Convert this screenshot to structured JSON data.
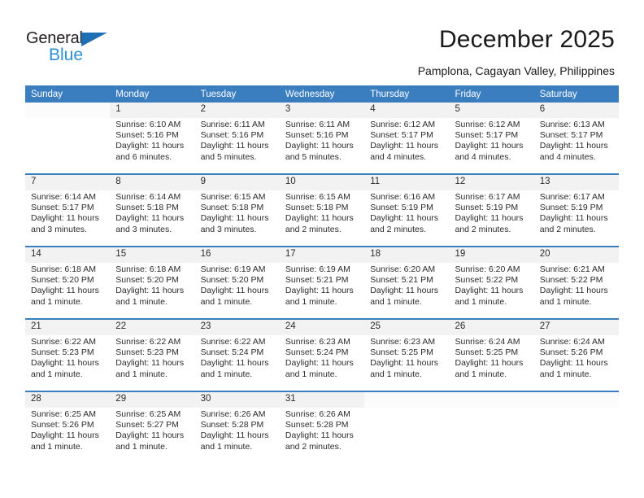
{
  "brand": {
    "name_top": "General",
    "name_bottom": "Blue",
    "accent_color": "#2b8fd6",
    "triangle_color": "#1f6fb5"
  },
  "header": {
    "title": "December 2025",
    "subtitle": "Pamplona, Cagayan Valley, Philippines"
  },
  "calendar": {
    "header_bg": "#3b7ebf",
    "daynum_bg": "#f2f2f2",
    "weekday_names": [
      "Sunday",
      "Monday",
      "Tuesday",
      "Wednesday",
      "Thursday",
      "Friday",
      "Saturday"
    ],
    "weeks": [
      [
        {
          "day": "",
          "sunrise": "",
          "sunset": "",
          "daylight": ""
        },
        {
          "day": "1",
          "sunrise": "Sunrise: 6:10 AM",
          "sunset": "Sunset: 5:16 PM",
          "daylight": "Daylight: 11 hours and 6 minutes."
        },
        {
          "day": "2",
          "sunrise": "Sunrise: 6:11 AM",
          "sunset": "Sunset: 5:16 PM",
          "daylight": "Daylight: 11 hours and 5 minutes."
        },
        {
          "day": "3",
          "sunrise": "Sunrise: 6:11 AM",
          "sunset": "Sunset: 5:16 PM",
          "daylight": "Daylight: 11 hours and 5 minutes."
        },
        {
          "day": "4",
          "sunrise": "Sunrise: 6:12 AM",
          "sunset": "Sunset: 5:17 PM",
          "daylight": "Daylight: 11 hours and 4 minutes."
        },
        {
          "day": "5",
          "sunrise": "Sunrise: 6:12 AM",
          "sunset": "Sunset: 5:17 PM",
          "daylight": "Daylight: 11 hours and 4 minutes."
        },
        {
          "day": "6",
          "sunrise": "Sunrise: 6:13 AM",
          "sunset": "Sunset: 5:17 PM",
          "daylight": "Daylight: 11 hours and 4 minutes."
        }
      ],
      [
        {
          "day": "7",
          "sunrise": "Sunrise: 6:14 AM",
          "sunset": "Sunset: 5:17 PM",
          "daylight": "Daylight: 11 hours and 3 minutes."
        },
        {
          "day": "8",
          "sunrise": "Sunrise: 6:14 AM",
          "sunset": "Sunset: 5:18 PM",
          "daylight": "Daylight: 11 hours and 3 minutes."
        },
        {
          "day": "9",
          "sunrise": "Sunrise: 6:15 AM",
          "sunset": "Sunset: 5:18 PM",
          "daylight": "Daylight: 11 hours and 3 minutes."
        },
        {
          "day": "10",
          "sunrise": "Sunrise: 6:15 AM",
          "sunset": "Sunset: 5:18 PM",
          "daylight": "Daylight: 11 hours and 2 minutes."
        },
        {
          "day": "11",
          "sunrise": "Sunrise: 6:16 AM",
          "sunset": "Sunset: 5:19 PM",
          "daylight": "Daylight: 11 hours and 2 minutes."
        },
        {
          "day": "12",
          "sunrise": "Sunrise: 6:17 AM",
          "sunset": "Sunset: 5:19 PM",
          "daylight": "Daylight: 11 hours and 2 minutes."
        },
        {
          "day": "13",
          "sunrise": "Sunrise: 6:17 AM",
          "sunset": "Sunset: 5:19 PM",
          "daylight": "Daylight: 11 hours and 2 minutes."
        }
      ],
      [
        {
          "day": "14",
          "sunrise": "Sunrise: 6:18 AM",
          "sunset": "Sunset: 5:20 PM",
          "daylight": "Daylight: 11 hours and 1 minute."
        },
        {
          "day": "15",
          "sunrise": "Sunrise: 6:18 AM",
          "sunset": "Sunset: 5:20 PM",
          "daylight": "Daylight: 11 hours and 1 minute."
        },
        {
          "day": "16",
          "sunrise": "Sunrise: 6:19 AM",
          "sunset": "Sunset: 5:20 PM",
          "daylight": "Daylight: 11 hours and 1 minute."
        },
        {
          "day": "17",
          "sunrise": "Sunrise: 6:19 AM",
          "sunset": "Sunset: 5:21 PM",
          "daylight": "Daylight: 11 hours and 1 minute."
        },
        {
          "day": "18",
          "sunrise": "Sunrise: 6:20 AM",
          "sunset": "Sunset: 5:21 PM",
          "daylight": "Daylight: 11 hours and 1 minute."
        },
        {
          "day": "19",
          "sunrise": "Sunrise: 6:20 AM",
          "sunset": "Sunset: 5:22 PM",
          "daylight": "Daylight: 11 hours and 1 minute."
        },
        {
          "day": "20",
          "sunrise": "Sunrise: 6:21 AM",
          "sunset": "Sunset: 5:22 PM",
          "daylight": "Daylight: 11 hours and 1 minute."
        }
      ],
      [
        {
          "day": "21",
          "sunrise": "Sunrise: 6:22 AM",
          "sunset": "Sunset: 5:23 PM",
          "daylight": "Daylight: 11 hours and 1 minute."
        },
        {
          "day": "22",
          "sunrise": "Sunrise: 6:22 AM",
          "sunset": "Sunset: 5:23 PM",
          "daylight": "Daylight: 11 hours and 1 minute."
        },
        {
          "day": "23",
          "sunrise": "Sunrise: 6:22 AM",
          "sunset": "Sunset: 5:24 PM",
          "daylight": "Daylight: 11 hours and 1 minute."
        },
        {
          "day": "24",
          "sunrise": "Sunrise: 6:23 AM",
          "sunset": "Sunset: 5:24 PM",
          "daylight": "Daylight: 11 hours and 1 minute."
        },
        {
          "day": "25",
          "sunrise": "Sunrise: 6:23 AM",
          "sunset": "Sunset: 5:25 PM",
          "daylight": "Daylight: 11 hours and 1 minute."
        },
        {
          "day": "26",
          "sunrise": "Sunrise: 6:24 AM",
          "sunset": "Sunset: 5:25 PM",
          "daylight": "Daylight: 11 hours and 1 minute."
        },
        {
          "day": "27",
          "sunrise": "Sunrise: 6:24 AM",
          "sunset": "Sunset: 5:26 PM",
          "daylight": "Daylight: 11 hours and 1 minute."
        }
      ],
      [
        {
          "day": "28",
          "sunrise": "Sunrise: 6:25 AM",
          "sunset": "Sunset: 5:26 PM",
          "daylight": "Daylight: 11 hours and 1 minute."
        },
        {
          "day": "29",
          "sunrise": "Sunrise: 6:25 AM",
          "sunset": "Sunset: 5:27 PM",
          "daylight": "Daylight: 11 hours and 1 minute."
        },
        {
          "day": "30",
          "sunrise": "Sunrise: 6:26 AM",
          "sunset": "Sunset: 5:28 PM",
          "daylight": "Daylight: 11 hours and 1 minute."
        },
        {
          "day": "31",
          "sunrise": "Sunrise: 6:26 AM",
          "sunset": "Sunset: 5:28 PM",
          "daylight": "Daylight: 11 hours and 2 minutes."
        },
        {
          "day": "",
          "sunrise": "",
          "sunset": "",
          "daylight": ""
        },
        {
          "day": "",
          "sunrise": "",
          "sunset": "",
          "daylight": ""
        },
        {
          "day": "",
          "sunrise": "",
          "sunset": "",
          "daylight": ""
        }
      ]
    ]
  }
}
